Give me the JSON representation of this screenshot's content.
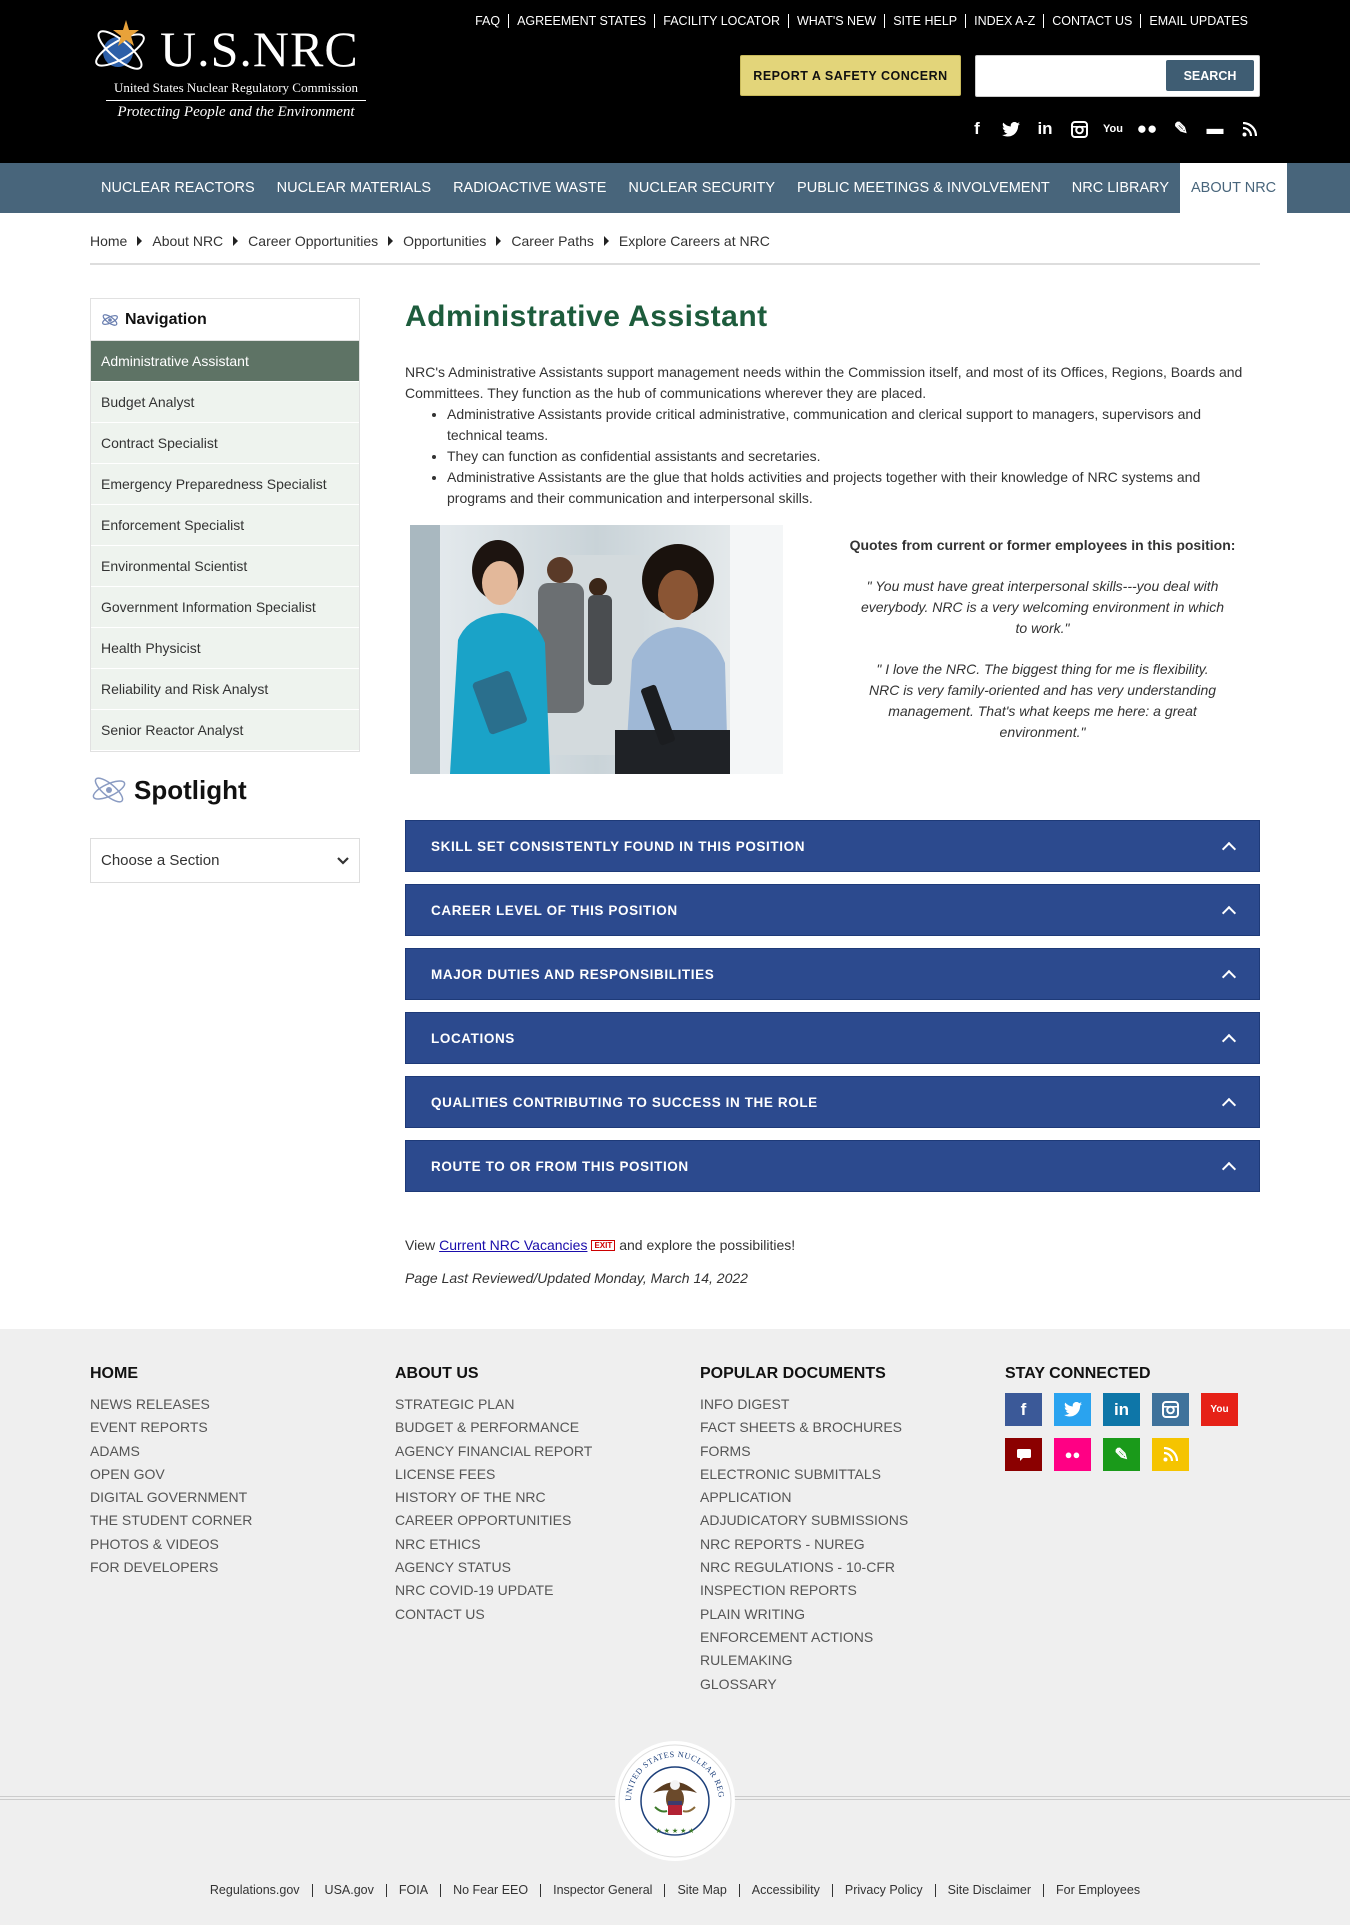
{
  "header": {
    "logo_text": "U.S.NRC",
    "logo_subtitle": "United States Nuclear Regulatory Commission",
    "logo_tagline": "Protecting People and the Environment",
    "utility_links": [
      "FAQ",
      "AGREEMENT STATES",
      "FACILITY LOCATOR",
      "WHAT'S NEW",
      "SITE HELP",
      "INDEX A-Z",
      "CONTACT US",
      "EMAIL UPDATES"
    ],
    "report_button": "REPORT A SAFETY CONCERN",
    "search_placeholder": "",
    "search_button": "SEARCH",
    "social_icons": [
      "facebook-icon",
      "twitter-icon",
      "linkedin-icon",
      "instagram-icon",
      "youtube-icon",
      "flickr-icon",
      "blog-icon",
      "comment-icon",
      "rss-icon"
    ]
  },
  "main_nav": [
    {
      "label": "NUCLEAR REACTORS",
      "active": false
    },
    {
      "label": "NUCLEAR MATERIALS",
      "active": false
    },
    {
      "label": "RADIOACTIVE WASTE",
      "active": false
    },
    {
      "label": "NUCLEAR SECURITY",
      "active": false
    },
    {
      "label": "PUBLIC MEETINGS & INVOLVEMENT",
      "active": false
    },
    {
      "label": "NRC LIBRARY",
      "active": false
    },
    {
      "label": "ABOUT NRC",
      "active": true
    }
  ],
  "breadcrumb": [
    "Home",
    "About NRC",
    "Career Opportunities",
    "Opportunities",
    "Career Paths",
    "Explore Careers at NRC"
  ],
  "sidebar": {
    "nav_title": "Navigation",
    "items": [
      {
        "label": "Administrative Assistant",
        "active": true
      },
      {
        "label": "Budget Analyst",
        "active": false
      },
      {
        "label": "Contract Specialist",
        "active": false
      },
      {
        "label": "Emergency Preparedness Specialist",
        "active": false
      },
      {
        "label": "Enforcement Specialist",
        "active": false
      },
      {
        "label": "Environmental Scientist",
        "active": false
      },
      {
        "label": "Government Information Specialist",
        "active": false
      },
      {
        "label": "Health Physicist",
        "active": false
      },
      {
        "label": "Reliability and Risk Analyst",
        "active": false
      },
      {
        "label": "Senior Reactor Analyst",
        "active": false
      }
    ],
    "spotlight_title": "Spotlight",
    "choose_section": "Choose a Section"
  },
  "content": {
    "title": "Administrative Assistant",
    "intro": "NRC's Administrative Assistants support management needs within the Commission itself, and most of its Offices, Regions, Boards and Committees. They function as the hub of communications wherever they are placed.",
    "bullets": [
      "Administrative Assistants provide critical administrative, communication and clerical support to managers, supervisors and technical teams.",
      "They can function as confidential assistants and secretaries.",
      "Administrative Assistants are the glue that holds activities and projects together with their knowledge of NRC systems and programs and their communication and interpersonal skills."
    ],
    "quotes_heading": "Quotes from current or former employees in this position:",
    "quotes": [
      "\" You must have great interpersonal skills---you deal with everybody. NRC is a very welcoming environment in which to work.\"",
      "\" I love the NRC. The biggest thing for me is flexibility. NRC is very family-oriented and has very understanding management. That's what keeps me here: a great environment.\""
    ],
    "accordions": [
      "SKILL SET CONSISTENTLY FOUND IN THIS POSITION",
      "CAREER LEVEL OF THIS POSITION",
      "MAJOR DUTIES AND RESPONSIBILITIES",
      "LOCATIONS",
      "QUALITIES CONTRIBUTING TO SUCCESS IN THE ROLE",
      "ROUTE TO OR FROM THIS POSITION"
    ],
    "vacancies_prefix": "View",
    "vacancies_link": "Current NRC Vacancies",
    "exit_badge": "EXIT",
    "vacancies_suffix": "and explore the possibilities!",
    "last_updated": "Page Last Reviewed/Updated Monday, March 14, 2022"
  },
  "footer": {
    "columns": [
      {
        "title": "HOME",
        "links": [
          "NEWS RELEASES",
          "EVENT REPORTS",
          "ADAMS",
          "OPEN GOV",
          "DIGITAL GOVERNMENT",
          "THE STUDENT CORNER",
          "PHOTOS & VIDEOS",
          "FOR DEVELOPERS"
        ]
      },
      {
        "title": "ABOUT US",
        "links": [
          "STRATEGIC PLAN",
          "BUDGET & PERFORMANCE",
          "AGENCY FINANCIAL REPORT",
          "LICENSE FEES",
          "HISTORY OF THE NRC",
          "CAREER OPPORTUNITIES",
          "NRC ETHICS",
          "AGENCY STATUS",
          "NRC COVID-19 UPDATE",
          "CONTACT US"
        ]
      },
      {
        "title": "POPULAR DOCUMENTS",
        "links": [
          "INFO DIGEST",
          "FACT SHEETS & BROCHURES",
          "FORMS",
          "ELECTRONIC SUBMITTALS",
          "APPLICATION",
          "ADJUDICATORY SUBMISSIONS",
          "NRC REPORTS - NUREG",
          "NRC REGULATIONS - 10-CFR",
          "INSPECTION REPORTS",
          "PLAIN WRITING",
          "ENFORCEMENT ACTIONS",
          "RULEMAKING",
          "GLOSSARY"
        ]
      }
    ],
    "stay_connected": "STAY CONNECTED",
    "social": [
      {
        "icon": "facebook-icon",
        "glyph": "f",
        "color": "#3b5998"
      },
      {
        "icon": "twitter-icon",
        "glyph": "t",
        "color": "#2aa3ef"
      },
      {
        "icon": "linkedin-icon",
        "glyph": "in",
        "color": "#0e76a8"
      },
      {
        "icon": "instagram-icon",
        "glyph": "◙",
        "color": "#3f729b"
      },
      {
        "icon": "youtube-icon",
        "glyph": "▶",
        "color": "#e62117"
      },
      {
        "icon": "comment-icon",
        "glyph": "▬",
        "color": "#8b0000"
      },
      {
        "icon": "flickr-icon",
        "glyph": "●●",
        "color": "#ff0084"
      },
      {
        "icon": "blog-icon",
        "glyph": "✎",
        "color": "#1a9a1a"
      },
      {
        "icon": "rss-icon",
        "glyph": "≋",
        "color": "#f5c400"
      }
    ],
    "seal_text": "UNITED STATES NUCLEAR REGULATORY COMMISSION",
    "bottom_links": [
      "Regulations.gov",
      "USA.gov",
      "FOIA",
      "No Fear EEO",
      "Inspector General",
      "Site Map",
      "Accessibility",
      "Privacy Policy",
      "Site Disclaimer",
      "For Employees"
    ]
  }
}
